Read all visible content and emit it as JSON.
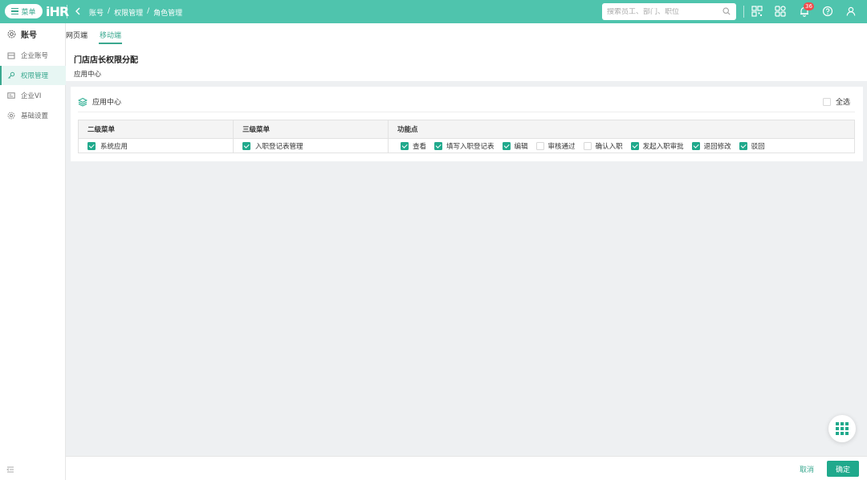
{
  "topbar": {
    "menu_label": "菜单",
    "logo_text": "iHR",
    "breadcrumb": [
      "账号",
      "/",
      "权限管理",
      "/",
      "角色管理"
    ],
    "search_placeholder": "搜索员工、部门、职位",
    "notification_count": "36"
  },
  "sidebar": {
    "title": "账号",
    "items": [
      {
        "label": "企业账号",
        "icon": "building-icon"
      },
      {
        "label": "权限管理",
        "icon": "key-icon",
        "active": true
      },
      {
        "label": "企业VI",
        "icon": "id-card-icon"
      },
      {
        "label": "基础设置",
        "icon": "settings-icon"
      }
    ]
  },
  "tabs": [
    "网页端",
    "移动端"
  ],
  "page": {
    "title": "门店店长权限分配",
    "subtitle": "应用中心"
  },
  "card": {
    "title": "应用中心",
    "select_all_label": "全选",
    "columns": [
      "二级菜单",
      "三级菜单",
      "功能点"
    ],
    "rows": [
      {
        "level2": {
          "label": "系统应用",
          "checked": true
        },
        "level3": {
          "label": "入职登记表管理",
          "checked": true
        },
        "functions": [
          {
            "label": "查看",
            "checked": true
          },
          {
            "label": "填写入职登记表",
            "checked": true
          },
          {
            "label": "编辑",
            "checked": true
          },
          {
            "label": "审核通过",
            "checked": false
          },
          {
            "label": "确认入职",
            "checked": false
          },
          {
            "label": "发起入职审批",
            "checked": true
          },
          {
            "label": "退回修改",
            "checked": true
          },
          {
            "label": "驳回",
            "checked": true
          }
        ]
      }
    ]
  },
  "footer": {
    "cancel_label": "取消",
    "confirm_label": "确定"
  },
  "colors": {
    "brand": "#4fc4ad",
    "accent": "#20a98c",
    "badge": "#f04a4a"
  }
}
